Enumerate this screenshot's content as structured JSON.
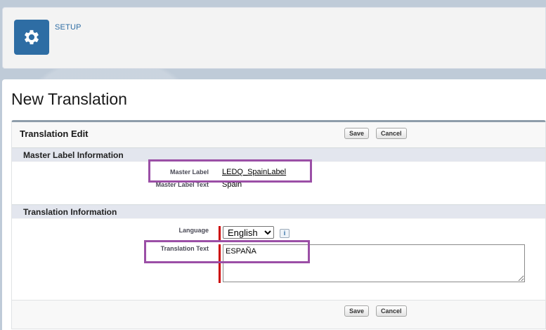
{
  "header": {
    "setup_label": "SETUP"
  },
  "page": {
    "title": "New Translation"
  },
  "block": {
    "title": "Translation Edit",
    "save_label": "Save",
    "cancel_label": "Cancel"
  },
  "master_section": {
    "heading": "Master Label Information",
    "master_label_label": "Master Label",
    "master_label_value": "LEDQ_SpainLabel",
    "master_label_text_label": "Master Label Text",
    "master_label_text_value": "Spain"
  },
  "translation_section": {
    "heading": "Translation Information",
    "language_label": "Language",
    "language_value": "English",
    "info_glyph": "i",
    "translation_text_label": "Translation Text",
    "translation_text_value": "ESPAÑA"
  },
  "colors": {
    "brand": "#2e6da4",
    "highlight": "#9b4fa6",
    "required": "#cc0000"
  }
}
